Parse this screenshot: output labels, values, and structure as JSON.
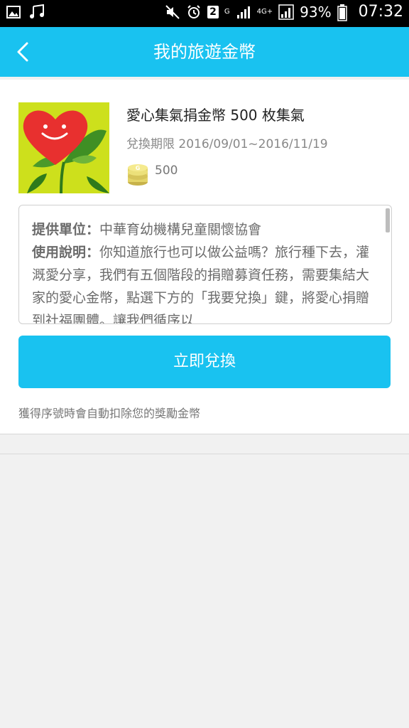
{
  "statusbar": {
    "network": "4G+",
    "network_g": "G",
    "sim_badge": "2",
    "battery": "93%",
    "time": "07:32"
  },
  "appbar": {
    "title": "我的旅遊金幣"
  },
  "item": {
    "title": "愛心集氣捐金幣 500 枚集氣",
    "period": "兌換期限 2016/09/01~2016/11/19",
    "coins": "500"
  },
  "description": {
    "provider_label": "提供單位：",
    "provider_value": "中華育幼機構兒童關懷協會",
    "usage_label": "使用說明：",
    "usage_text": "你知道旅行也可以做公益嗎？旅行種下去，灌溉愛分享，我們有五個階段的捐贈募資任務，需要集結大家的愛心金幣，點選下方的「我要兌換」鍵，將愛心捐贈到社福團體。讓我們循序以"
  },
  "actions": {
    "redeem_label": "立即兌換"
  },
  "hint": "獲得序號時會自動扣除您的獎勵金幣",
  "colors": {
    "accent": "#19c2f0",
    "heart": "#e8302f",
    "thumb_bg": "#cde01c"
  }
}
